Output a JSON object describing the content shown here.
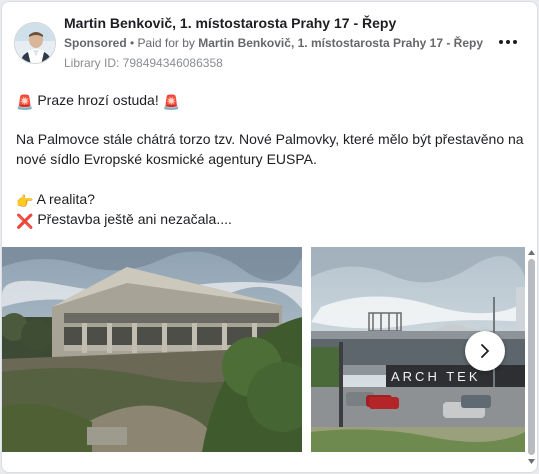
{
  "post": {
    "author": "Martin Benkovič, 1. místostarosta Prahy 17 - Řepy",
    "sponsored": "Sponsored",
    "paid_prefix": " • Paid for by ",
    "paid_by": "Martin Benkovič, 1. místostarosta Prahy 17 - Řepy",
    "library_id": "Library ID: 798494346086358",
    "more_icon": "more-horizontal-icon",
    "lines": {
      "l1": "Praze hrozí ostuda!",
      "l2": "Na Palmovce stále chátrá torzo tzv. Nové Palmovky, které mělo být přestavěno na",
      "l3": "nové sídlo Evropské kosmické agentury EUSPA.",
      "l4": "A realita?",
      "l5": "Přestavba ještě ani nezačala...."
    },
    "emoji": {
      "siren": "🚨",
      "pointing": "👉",
      "cross": "❌"
    }
  },
  "carousel": {
    "photo2_sign": "ARCH  TEK",
    "next_icon": "chevron-right-icon"
  }
}
